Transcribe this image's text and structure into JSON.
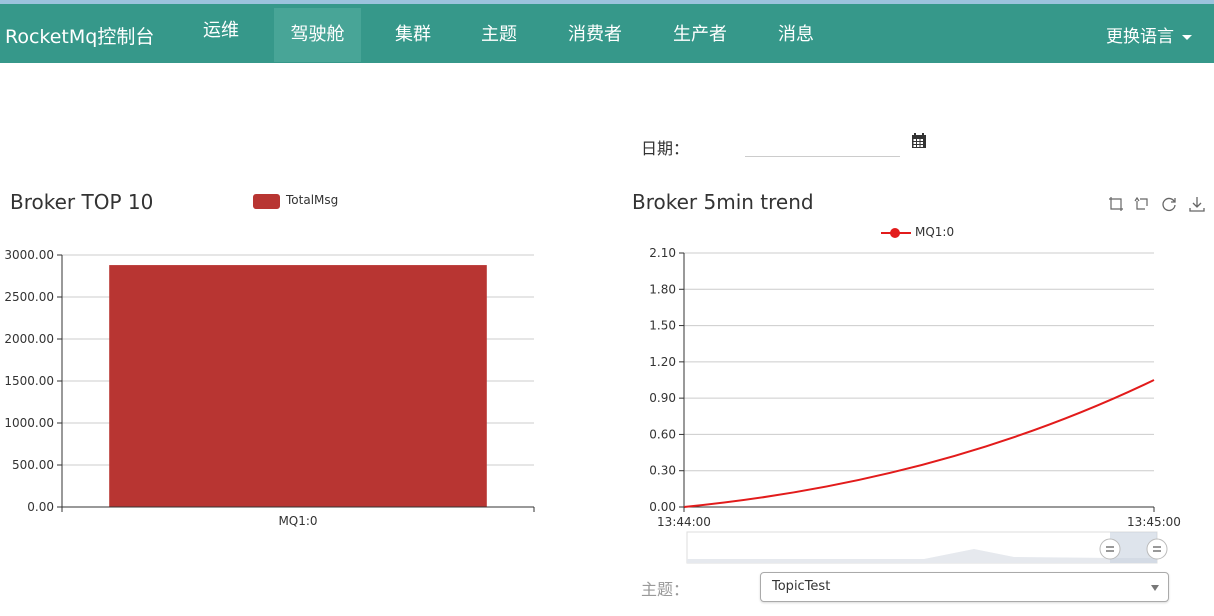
{
  "nav": {
    "brand": "RocketMq控制台",
    "items": [
      {
        "label": "运维"
      },
      {
        "label": "驾驶舱"
      },
      {
        "label": "集群"
      },
      {
        "label": "主题"
      },
      {
        "label": "消费者"
      },
      {
        "label": "生产者"
      },
      {
        "label": "消息"
      }
    ],
    "active_index": 1,
    "language_label": "更换语言"
  },
  "date_filter": {
    "label": "日期：",
    "value": ""
  },
  "colors": {
    "navbar": "#36988a",
    "nav_active": "#48a597",
    "bar": "#b83532",
    "trend_line": "#e21b1b"
  },
  "icons": [
    "calendar-icon",
    "zoom-icon",
    "zoom-reset-icon",
    "restore-icon",
    "download-icon",
    "caret-down-icon"
  ],
  "broker_top": {
    "title": "Broker TOP 10",
    "legend": "TotalMsg"
  },
  "broker_trend": {
    "title": "Broker 5min trend",
    "legend": "MQ1:0"
  },
  "topic_filter": {
    "label": "主题：",
    "selected": "TopicTest"
  },
  "chart_data": [
    {
      "type": "bar",
      "title": "Broker TOP 10",
      "categories": [
        "MQ1:0"
      ],
      "series": [
        {
          "name": "TotalMsg",
          "values": [
            2880
          ]
        }
      ],
      "ylim": [
        0,
        3000
      ],
      "yticks": [
        "0.00",
        "500.00",
        "1000.00",
        "1500.00",
        "2000.00",
        "2500.00",
        "3000.00"
      ],
      "grid": true,
      "legend_position": "top"
    },
    {
      "type": "line",
      "title": "Broker 5min trend",
      "x": [
        "13:44:00",
        "13:45:00"
      ],
      "series": [
        {
          "name": "MQ1:0",
          "values": [
            0,
            1.05
          ]
        }
      ],
      "ylim": [
        0,
        2.1
      ],
      "yticks": [
        "0.00",
        "0.30",
        "0.60",
        "0.90",
        "1.20",
        "1.50",
        "1.80",
        "2.10"
      ],
      "grid": true,
      "legend_position": "top",
      "data_zoom": [
        0.9,
        1.0
      ]
    }
  ]
}
